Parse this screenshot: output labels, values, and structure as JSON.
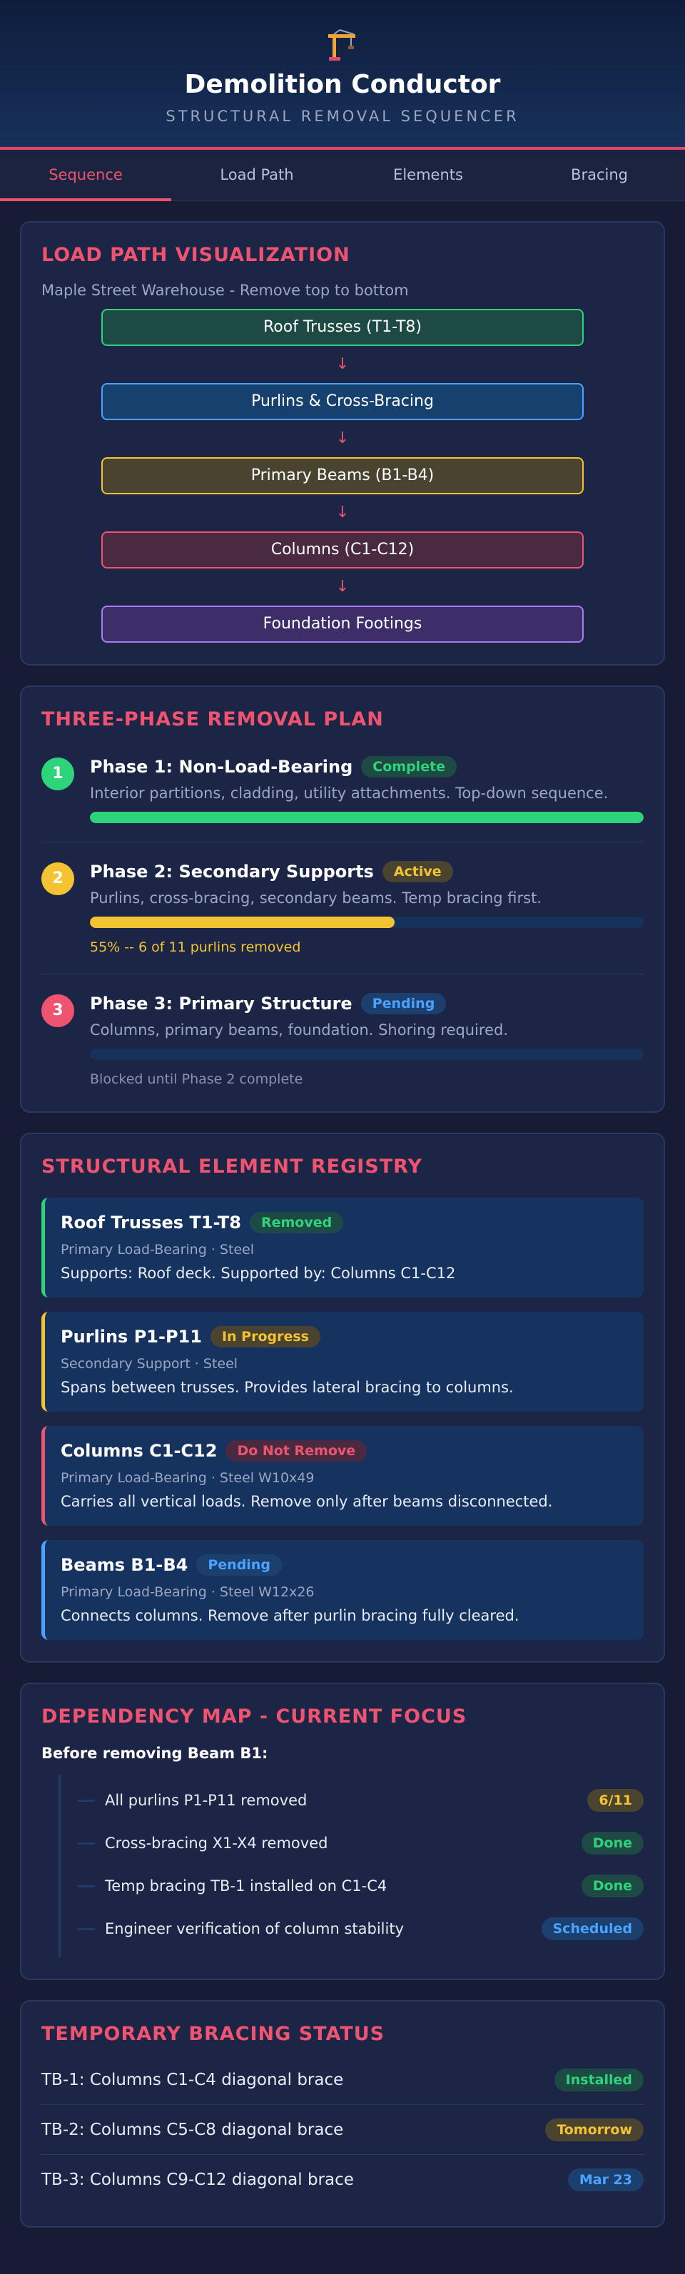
{
  "header": {
    "title": "Demolition Conductor",
    "subtitle": "STRUCTURAL REMOVAL SEQUENCER"
  },
  "tabs": [
    {
      "label": "Sequence",
      "active": true
    },
    {
      "label": "Load Path",
      "active": false
    },
    {
      "label": "Elements",
      "active": false
    },
    {
      "label": "Bracing",
      "active": false
    }
  ],
  "load_path": {
    "title": "LOAD PATH VISUALIZATION",
    "subtitle": "Maple Street Warehouse - Remove top to bottom",
    "arrow": "↓",
    "levels": [
      {
        "label": "Roof Trusses (T1-T8)",
        "border": "#2ed47a",
        "bg": "#1d4a45"
      },
      {
        "label": "Purlins & Cross-Bracing",
        "border": "#4aa3ff",
        "bg": "#16406e"
      },
      {
        "label": "Primary Beams (B1-B4)",
        "border": "#f4c331",
        "bg": "#4a4330"
      },
      {
        "label": "Columns (C1-C12)",
        "border": "#ee5470",
        "bg": "#4a2a40"
      },
      {
        "label": "Foundation Footings",
        "border": "#a77cf0",
        "bg": "#3d2e6a"
      }
    ]
  },
  "plan": {
    "title": "THREE-PHASE REMOVAL PLAN",
    "phases": [
      {
        "num": "1",
        "name": "Phase 1: Non-Load-Bearing",
        "status": "Complete",
        "desc": "Interior partitions, cladding, utility attachments. Top-down sequence.",
        "progress": 1.0,
        "note": "",
        "color": "#2ed47a"
      },
      {
        "num": "2",
        "name": "Phase 2: Secondary Supports",
        "status": "Active",
        "desc": "Purlins, cross-bracing, secondary beams. Temp bracing first.",
        "progress": 0.55,
        "note": "55% -- 6 of 11 purlins removed",
        "color": "#f4c331"
      },
      {
        "num": "3",
        "name": "Phase 3: Primary Structure",
        "status": "Pending",
        "desc": "Columns, primary beams, foundation. Shoring required.",
        "progress": 0,
        "note": "Blocked until Phase 2 complete",
        "color": "#ee5470"
      }
    ]
  },
  "registry": {
    "title": "STRUCTURAL ELEMENT REGISTRY",
    "items": [
      {
        "name": "Roof Trusses T1-T8",
        "status": "Removed",
        "meta": "Primary Load-Bearing · Steel",
        "desc": "Supports: Roof deck. Supported by: Columns C1-C12",
        "color": "#2ed47a"
      },
      {
        "name": "Purlins P1-P11",
        "status": "In Progress",
        "meta": "Secondary Support · Steel",
        "desc": "Spans between trusses. Provides lateral bracing to columns.",
        "color": "#f4c331"
      },
      {
        "name": "Columns C1-C12",
        "status": "Do Not Remove",
        "meta": "Primary Load-Bearing · Steel W10x49",
        "desc": "Carries all vertical loads. Remove only after beams disconnected.",
        "color": "#ee5470"
      },
      {
        "name": "Beams B1-B4",
        "status": "Pending",
        "meta": "Primary Load-Bearing · Steel W12x26",
        "desc": "Connects columns. Remove after purlin bracing fully cleared.",
        "color": "#4aa3ff"
      }
    ]
  },
  "dependency": {
    "title": "DEPENDENCY MAP - CURRENT FOCUS",
    "label": "Before removing Beam B1:",
    "items": [
      {
        "text": "All purlins P1-P11 removed",
        "status": "6/11",
        "tone": "yellow"
      },
      {
        "text": "Cross-bracing X1-X4 removed",
        "status": "Done",
        "tone": "green"
      },
      {
        "text": "Temp bracing TB-1 installed on C1-C4",
        "status": "Done",
        "tone": "green"
      },
      {
        "text": "Engineer verification of column stability",
        "status": "Scheduled",
        "tone": "blue"
      }
    ]
  },
  "bracing": {
    "title": "TEMPORARY BRACING STATUS",
    "items": [
      {
        "text": "TB-1: Columns C1-C4 diagonal brace",
        "status": "Installed",
        "tone": "green"
      },
      {
        "text": "TB-2: Columns C5-C8 diagonal brace",
        "status": "Tomorrow",
        "tone": "yellow"
      },
      {
        "text": "TB-3: Columns C9-C12 diagonal brace",
        "status": "Mar 23",
        "tone": "blue"
      }
    ]
  }
}
